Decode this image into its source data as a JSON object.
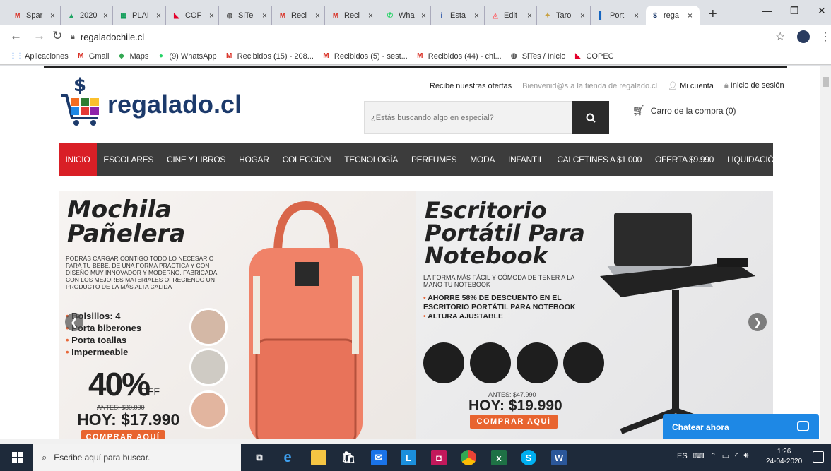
{
  "browser": {
    "tabs": [
      {
        "title": "Spar",
        "icon": "gmail-icon",
        "color": "#d93025",
        "glyph": "M"
      },
      {
        "title": "2020",
        "icon": "drive-icon",
        "color": "#1fa463",
        "glyph": "▲"
      },
      {
        "title": "PLAI",
        "icon": "sheets-icon",
        "color": "#0f9d58",
        "glyph": "▦"
      },
      {
        "title": "COF",
        "icon": "copec-icon",
        "color": "#e4002b",
        "glyph": "◣"
      },
      {
        "title": "SiTe",
        "icon": "globe-icon",
        "color": "#555555",
        "glyph": "◍"
      },
      {
        "title": "Reci",
        "icon": "gmail-icon",
        "color": "#d93025",
        "glyph": "M"
      },
      {
        "title": "Reci",
        "icon": "gmail-icon",
        "color": "#d93025",
        "glyph": "M"
      },
      {
        "title": "Wha",
        "icon": "whatsapp-icon",
        "color": "#25d366",
        "glyph": "✆"
      },
      {
        "title": "Esta",
        "icon": "itau-icon",
        "color": "#003399",
        "glyph": "i"
      },
      {
        "title": "Edit",
        "icon": "airbnb-icon",
        "color": "#ff5a5f",
        "glyph": "◬"
      },
      {
        "title": "Taro",
        "icon": "tarot-icon",
        "color": "#c8a040",
        "glyph": "✦"
      },
      {
        "title": "Port",
        "icon": "portal-icon",
        "color": "#1565c0",
        "glyph": "▌"
      },
      {
        "title": "rega",
        "icon": "regalado-icon",
        "color": "#1c3a6b",
        "glyph": "$",
        "active": true
      }
    ],
    "url": "regaladochile.cl",
    "bookmarks": [
      {
        "label": "Aplicaciones",
        "icon": "apps-grid-icon",
        "color": "#1a73e8",
        "glyph": "⋮⋮"
      },
      {
        "label": "Gmail",
        "icon": "gmail-icon",
        "color": "#d93025",
        "glyph": "M"
      },
      {
        "label": "Maps",
        "icon": "maps-icon",
        "color": "#34a853",
        "glyph": "◆"
      },
      {
        "label": "(9) WhatsApp",
        "icon": "whatsapp-icon",
        "color": "#25d366",
        "glyph": "●"
      },
      {
        "label": "Recibidos (15) - 208...",
        "icon": "gmail-icon",
        "color": "#d93025",
        "glyph": "M"
      },
      {
        "label": "Recibidos (5) - sest...",
        "icon": "gmail-icon",
        "color": "#d93025",
        "glyph": "M"
      },
      {
        "label": "Recibidos (44) - chi...",
        "icon": "gmail-icon",
        "color": "#d93025",
        "glyph": "M"
      },
      {
        "label": "SiTes / Inicio",
        "icon": "globe-icon",
        "color": "#555555",
        "glyph": "◍"
      },
      {
        "label": "COPEC",
        "icon": "copec-icon",
        "color": "#e4002b",
        "glyph": "◣"
      }
    ]
  },
  "site": {
    "logo_text": "regalado.cl",
    "top_links": {
      "offers": "Recibe nuestras ofertas",
      "welcome": "Bienvenid@s a la tienda de regalado.cl",
      "account": "Mi cuenta",
      "login": "Inicio de sesión"
    },
    "search_placeholder": "¿Estás buscando algo en especial?",
    "cart": "Carro de la compra (0)",
    "nav": [
      "INICIO",
      "ESCOLARES",
      "CINE Y LIBROS",
      "HOGAR",
      "COLECCIÓN",
      "TECNOLOGÍA",
      "PERFUMES",
      "MODA",
      "INFANTIL",
      "CALCETINES A $1.000",
      "OFERTA $9.990",
      "LIQUIDACIÓN MOLETTO"
    ],
    "accent": "#d91f26"
  },
  "banner": {
    "left": {
      "title1": "Mochila",
      "title2": "Pañelera",
      "desc": "PODRÁS CARGAR CONTIGO TODO LO NECESARIO PARA TU BEBÉ, DE UNA FORMA PRÁCTICA Y CON DISEÑO MUY INNOVADOR Y MODERNO. FABRICADA CON LOS MEJORES MATERIALES OFRECIENDO UN PRODUCTO DE LA MÁS ALTA CALIDA",
      "bullets": [
        "Bolsillos: 4",
        "Porta biberones",
        "Porta toallas",
        "Impermeable"
      ],
      "discount": "40%",
      "off": "OFF",
      "old_price": "ANTES: $30.000",
      "price": "HOY: $17.990",
      "cta": "COMPRAR AQUÍ"
    },
    "right": {
      "title1": "Escritorio",
      "title2": "Portátil Para",
      "title3": "Notebook",
      "desc": "LA FORMA MÁS FÁCIL Y CÓMODA DE TENER A LA MANO TU NOTEBOOK",
      "bullets": [
        "AHORRE 58% DE DESCUENTO EN EL ESCRITORIO PORTÁTIL PARA NOTEBOOK",
        "ALTURA AJUSTABLE"
      ],
      "old_price": "ANTES: $47.990",
      "price": "HOY: $19.990",
      "cta": "COMPRAR AQUÍ"
    }
  },
  "chat": {
    "label": "Chatear ahora"
  },
  "taskbar": {
    "search_placeholder": "Escribe aquí para buscar.",
    "lang": "ES",
    "time": "1:26",
    "date": "24-04-2020"
  }
}
